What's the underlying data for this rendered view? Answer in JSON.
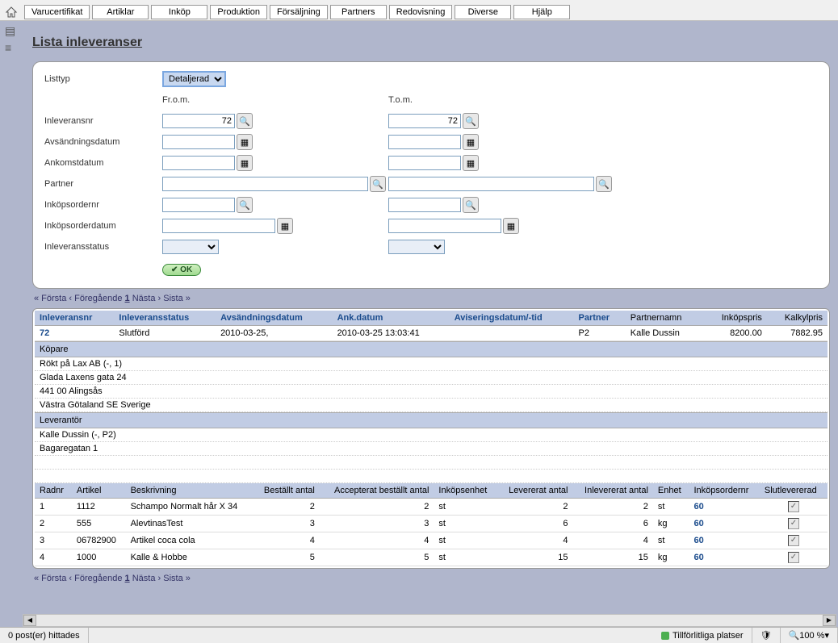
{
  "menu": [
    "Varucertifikat",
    "Artiklar",
    "Inköp",
    "Produktion",
    "Försäljning",
    "Partners",
    "Redovisning",
    "Diverse",
    "Hjälp"
  ],
  "page_title": "Lista inleveranser",
  "filters": {
    "listtyp_label": "Listtyp",
    "listtyp_value": "Detaljerad",
    "from_label": "Fr.o.m.",
    "to_label": "T.o.m.",
    "inlevnr_label": "Inleveransnr",
    "inlevnr_from": "72",
    "inlevnr_to": "72",
    "avsdatum_label": "Avsändningsdatum",
    "ankdatum_label": "Ankomstdatum",
    "partner_label": "Partner",
    "inkordernr_label": "Inköpsordernr",
    "inkorderdatum_label": "Inköpsorderdatum",
    "inlevstatus_label": "Inleveransstatus",
    "ok_label": "OK"
  },
  "pager": {
    "first": "« Första",
    "prev": "‹ Föregående",
    "page": "1",
    "next": "Nästa ›",
    "last": "Sista »"
  },
  "headers1": {
    "inlevnr": "Inleveransnr",
    "status": "Inleveransstatus",
    "avsdatum": "Avsändningsdatum",
    "ankdatum": "Ank.datum",
    "avisering": "Aviseringsdatum/-tid",
    "partner": "Partner",
    "partnernamn": "Partnernamn",
    "inkopspris": "Inköpspris",
    "kalkylpris": "Kalkylpris"
  },
  "row1": {
    "inlevnr": "72",
    "status": "Slutförd",
    "avsdatum": "2010-03-25,",
    "ankdatum": "2010-03-25 13:03:41",
    "avisering": "",
    "partner": "P2",
    "partnernamn": "Kalle Dussin",
    "inkopspris": "8200.00",
    "kalkylpris": "7882.95"
  },
  "kopare": {
    "head": "Köpare",
    "l1": "Rökt på Lax AB   (-, 1)",
    "l2": "Glada Laxens gata 24",
    "l3": "441 00 Alingsås",
    "l4": "Västra Götaland SE Sverige"
  },
  "leverantor": {
    "head": "Leverantör",
    "l1": "Kalle Dussin   (-, P2)",
    "l2": "Bagaregatan 1"
  },
  "headers2": {
    "radnr": "Radnr",
    "artikel": "Artikel",
    "beskrivning": "Beskrivning",
    "bestallt": "Beställt antal",
    "accepterat": "Accepterat beställt antal",
    "inkenhet": "Inköpsenhet",
    "levererat": "Levererat antal",
    "inlevererat": "Inlevererat antal",
    "enhet": "Enhet",
    "inkordernr": "Inköpsordernr",
    "slutlev": "Slutlevererad"
  },
  "rows2": [
    {
      "radnr": "1",
      "artikel": "1112",
      "beskrivning": "Schampo Normalt hår X 34",
      "bestallt": "2",
      "accepterat": "2",
      "inkenhet": "st",
      "levererat": "2",
      "inlevererat": "2",
      "enhet": "st",
      "inkordernr": "60"
    },
    {
      "radnr": "2",
      "artikel": "555",
      "beskrivning": "AlevtinasTest",
      "bestallt": "3",
      "accepterat": "3",
      "inkenhet": "st",
      "levererat": "6",
      "inlevererat": "6",
      "enhet": "kg",
      "inkordernr": "60"
    },
    {
      "radnr": "3",
      "artikel": "06782900",
      "beskrivning": "Artikel coca cola",
      "bestallt": "4",
      "accepterat": "4",
      "inkenhet": "st",
      "levererat": "4",
      "inlevererat": "4",
      "enhet": "st",
      "inkordernr": "60"
    },
    {
      "radnr": "4",
      "artikel": "1000",
      "beskrivning": "Kalle & Hobbe",
      "bestallt": "5",
      "accepterat": "5",
      "inkenhet": "st",
      "levererat": "15",
      "inlevererat": "15",
      "enhet": "kg",
      "inkordernr": "60"
    }
  ],
  "statusbar": {
    "posts": "0 post(er) hittades",
    "zone": "Tillförlitliga platser",
    "zoom": "100 %"
  }
}
